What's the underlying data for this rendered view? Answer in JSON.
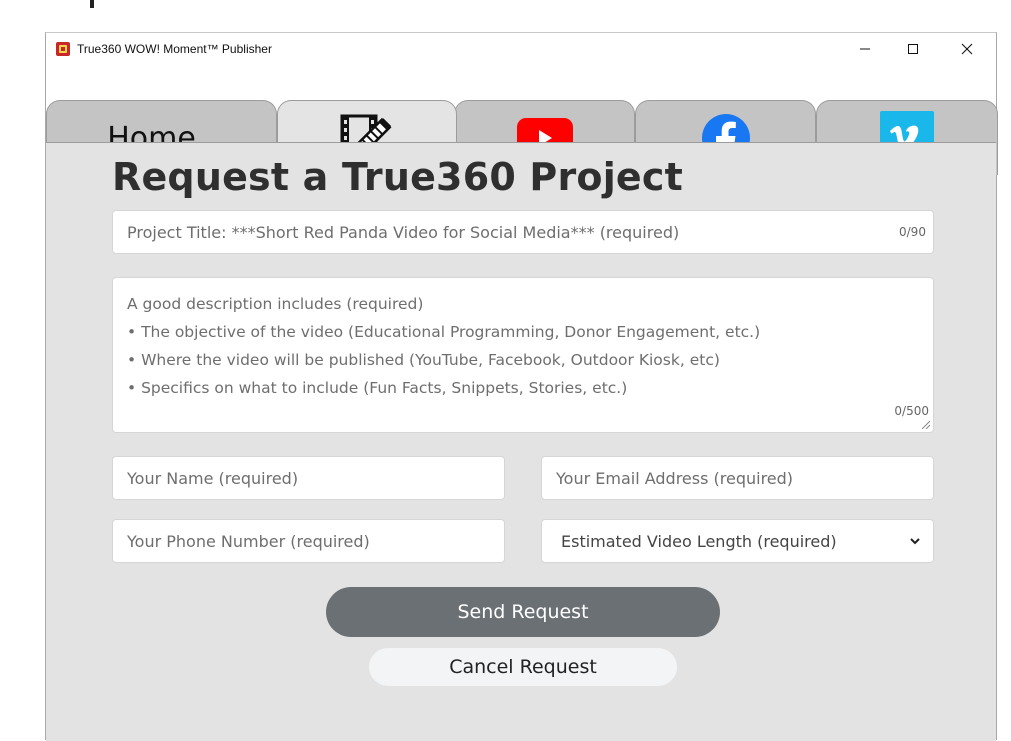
{
  "window": {
    "title": "True360 WOW! Moment™ Publisher",
    "controls": {
      "minimize": "–",
      "maximize": "☐",
      "close": "✕"
    }
  },
  "tabs": [
    {
      "label": "Home",
      "icon": null,
      "active": false
    },
    {
      "label": "",
      "icon": "edit-video-icon",
      "active": true
    },
    {
      "label": "",
      "icon": "youtube-icon",
      "active": false
    },
    {
      "label": "",
      "icon": "facebook-icon",
      "active": false
    },
    {
      "label": "",
      "icon": "vimeo-icon",
      "active": false
    }
  ],
  "form": {
    "heading": "Request a True360 Project",
    "project_title": {
      "placeholder": "Project Title: ***Short Red Panda Video for Social Media*** (required)",
      "counter": "0/90"
    },
    "description": {
      "lines": [
        "A good description includes (required)",
        "• The objective of the video (Educational Programming, Donor Engagement, etc.)",
        "• Where the video will be published (YouTube, Facebook, Outdoor Kiosk, etc)",
        "• Specifics on what to include (Fun Facts, Snippets, Stories, etc.)"
      ],
      "counter": "0/500"
    },
    "name": {
      "placeholder": "Your Name (required)"
    },
    "email": {
      "placeholder": "Your Email Address (required)"
    },
    "phone": {
      "placeholder": "Your Phone Number (required)"
    },
    "video_length": {
      "selected": "Estimated Video Length (required)"
    },
    "send_label": "Send Request",
    "cancel_label": "Cancel Request"
  },
  "colors": {
    "content_bg": "#e3e3e3",
    "tab_bg": "#c4c4c4",
    "active_tab_bg": "#e4e4e4",
    "send_button": "#6b7075",
    "youtube_red": "#ff0000",
    "facebook_blue": "#1877f2",
    "vimeo_cyan": "#1ab7ea"
  }
}
